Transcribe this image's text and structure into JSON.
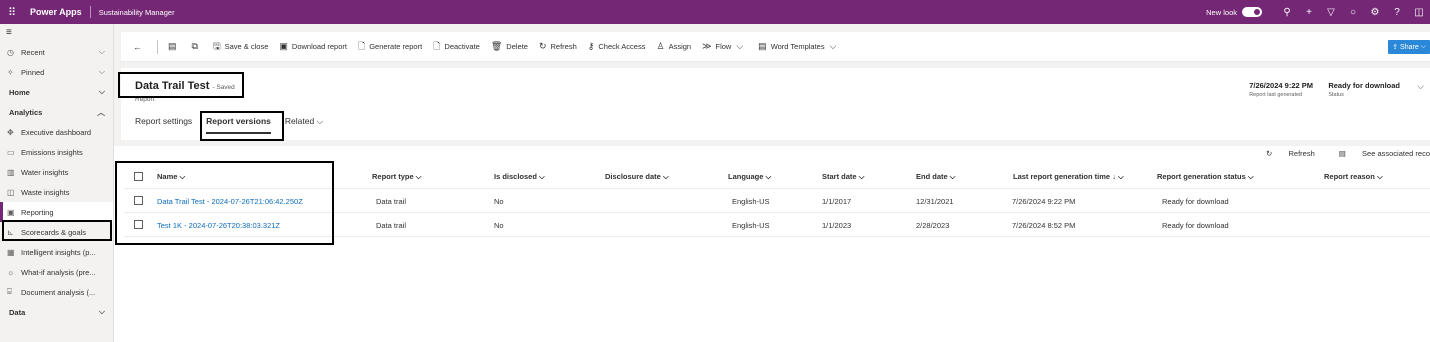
{
  "topbar": {
    "brand": "Power Apps",
    "app_name": "Sustainability Manager",
    "new_look_label": "New look",
    "icons": [
      "search-icon",
      "add-icon",
      "filter-icon",
      "lightbulb-icon",
      "settings-icon",
      "help-icon",
      "copilot-icon"
    ]
  },
  "sidebar": {
    "items": [
      {
        "label": "Recent",
        "icon": "clock-icon"
      },
      {
        "label": "Pinned",
        "icon": "pin-icon"
      },
      {
        "label": "Home"
      },
      {
        "label": "Analytics"
      },
      {
        "label": "Executive dashboard",
        "icon": "dashboard-icon"
      },
      {
        "label": "Emissions insights",
        "icon": "emissions-icon"
      },
      {
        "label": "Water insights",
        "icon": "water-icon"
      },
      {
        "label": "Waste insights",
        "icon": "waste-icon"
      },
      {
        "label": "Reporting",
        "icon": "reporting-icon"
      },
      {
        "label": "Scorecards & goals",
        "icon": "scorecard-icon"
      },
      {
        "label": "Intelligent insights (p...",
        "icon": "insights-icon"
      },
      {
        "label": "What-if analysis (pre...",
        "icon": "whatif-icon"
      },
      {
        "label": "Document analysis (...",
        "icon": "document-icon"
      },
      {
        "label": "Data"
      }
    ]
  },
  "commandbar": {
    "save_close": "Save & close",
    "download_report": "Download report",
    "generate_report": "Generate report",
    "deactivate": "Deactivate",
    "delete": "Delete",
    "refresh": "Refresh",
    "check_access": "Check Access",
    "assign": "Assign",
    "flow": "Flow",
    "word_templates": "Word Templates",
    "share": "Share"
  },
  "record": {
    "title": "Data Trail Test",
    "saved_status": "- Saved",
    "entity": "Report",
    "tabs": [
      "Report settings",
      "Report versions",
      "Related"
    ],
    "last_generated_value": "7/26/2024 9:22 PM",
    "last_generated_label": "Report last generated",
    "status_value": "Ready for download",
    "status_label": "Status"
  },
  "grid": {
    "refresh": "Refresh",
    "see_associated": "See associated reco",
    "columns": [
      "Name",
      "Report type",
      "Is disclosed",
      "Disclosure date",
      "Language",
      "Start date",
      "End date",
      "Last report generation time",
      "Report generation status",
      "Report reason"
    ],
    "rows": [
      {
        "name": "Data Trail Test - 2024-07-26T21:06:42.250Z",
        "type": "Data trail",
        "disclosed": "No",
        "disclosure_date": "",
        "language": "English-US",
        "start": "1/1/2017",
        "end": "12/31/2021",
        "last_gen": "7/26/2024 9:22 PM",
        "status": "Ready for download",
        "reason": ""
      },
      {
        "name": "Test 1K - 2024-07-26T20:38:03.321Z",
        "type": "Data trail",
        "disclosed": "No",
        "disclosure_date": "",
        "language": "English-US",
        "start": "1/1/2023",
        "end": "2/28/2023",
        "last_gen": "7/26/2024 8:52 PM",
        "status": "Ready for download",
        "reason": ""
      }
    ]
  }
}
